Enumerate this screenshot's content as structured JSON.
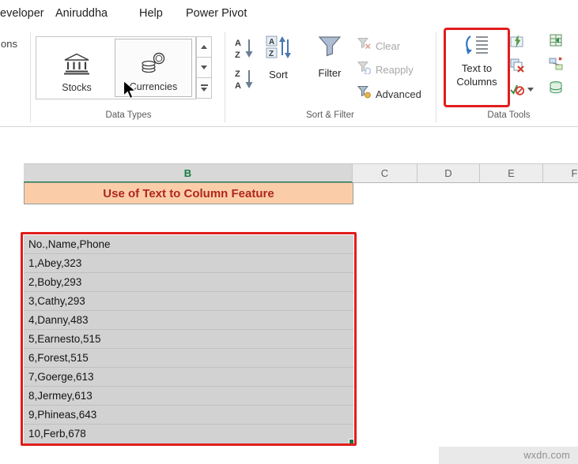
{
  "menubar": {
    "items": [
      "eveloper",
      "Aniruddha",
      "Help",
      "Power Pivot"
    ]
  },
  "ribbon": {
    "partial_text": "ons",
    "groups": {
      "data_types": {
        "label": "Data Types",
        "stocks": "Stocks",
        "currencies": "Currencies"
      },
      "sort_filter": {
        "label": "Sort & Filter",
        "sort": "Sort",
        "filter": "Filter",
        "clear": "Clear",
        "reapply": "Reapply",
        "advanced": "Advanced"
      },
      "data_tools": {
        "label": "Data Tools",
        "ttc": [
          "Text to",
          "Columns"
        ]
      }
    }
  },
  "sheet": {
    "column_headers": [
      "B",
      "C",
      "D",
      "E",
      "F"
    ],
    "title_cell": "Use of Text to Column Feature",
    "rows": [
      "No.,Name,Phone",
      "1,Abey,323",
      "2,Boby,293",
      "3,Cathy,293",
      "4,Danny,483",
      "5,Earnesto,515",
      "6,Forest,515",
      "7,Goerge,613",
      "8,Jermey,613",
      "9,Phineas,643",
      "10,Ferb,678"
    ]
  },
  "watermark": "wxdn.com",
  "icons": {
    "stocks": "bank-icon",
    "currencies": "coins-icon",
    "sort_az": "sort-ascending-icon",
    "sort_za": "sort-descending-icon",
    "sort": "sort-icon",
    "filter": "funnel-icon",
    "clear": "clear-filter-icon",
    "reapply": "reapply-filter-icon",
    "advanced": "advanced-filter-icon",
    "text_to_columns": "text-to-columns-icon",
    "flash_fill": "flash-fill-icon",
    "remove_duplicates": "remove-duplicates-icon",
    "data_validation": "data-validation-icon",
    "consolidate": "consolidate-icon",
    "relationships": "relationships-icon",
    "data_model": "manage-data-model-icon"
  },
  "colors": {
    "excel_green": "#107C41",
    "annotation_red": "#E11D1D",
    "selection_gray": "#D2D2D2",
    "title_fill": "#FACDA8",
    "title_text": "#B0261C"
  }
}
